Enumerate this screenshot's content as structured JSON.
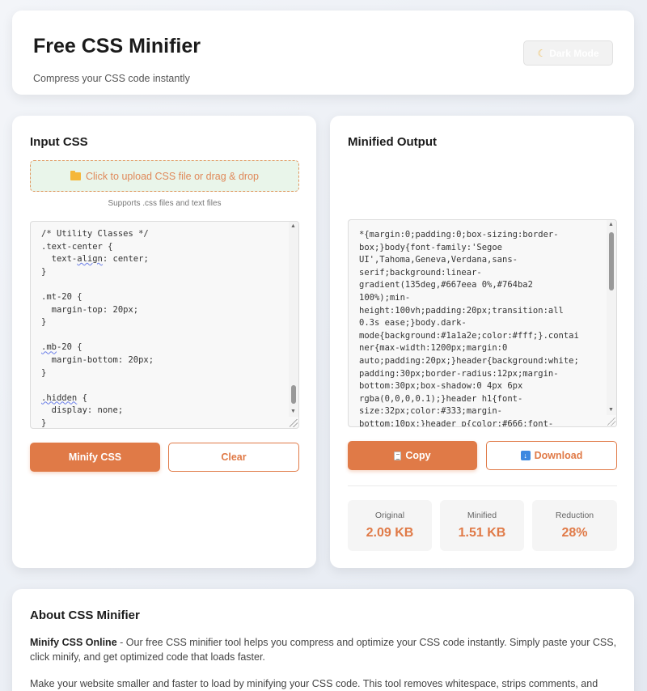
{
  "header": {
    "title": "Free CSS Minifier",
    "subtitle": "Compress your CSS code instantly",
    "dark_mode_label": "Dark Mode",
    "dark_mode_icon": "moon-icon"
  },
  "input": {
    "title": "Input CSS",
    "upload_label": "Click to upload CSS file or drag & drop",
    "upload_icon": "folder-icon",
    "upload_note": "Supports .css files and text files",
    "code_lines": [
      "/* Utility Classes */",
      ".text-center {",
      "  text-align: center;",
      "}",
      "",
      ".mt-20 {",
      "  margin-top: 20px;",
      "}",
      "",
      ".mb-20 {",
      "  margin-bottom: 20px;",
      "}",
      "",
      ".hidden {",
      "  display: none;",
      "}"
    ],
    "minify_label": "Minify CSS",
    "clear_label": "Clear"
  },
  "output": {
    "title": "Minified Output",
    "code_lines": [
      "*{margin:0;padding:0;box-sizing:border-",
      "box;}body{font-family:'Segoe",
      "UI',Tahoma,Geneva,Verdana,sans-",
      "serif;background:linear-",
      "gradient(135deg,#667eea 0%,#764ba2",
      "100%);min-",
      "height:100vh;padding:20px;transition:all",
      "0.3s ease;}body.dark-",
      "mode{background:#1a1a2e;color:#fff;}.contai",
      "ner{max-width:1200px;margin:0",
      "auto;padding:20px;}header{background:white;",
      "padding:30px;border-radius:12px;margin-",
      "bottom:30px;box-shadow:0 4px 6px",
      "rgba(0,0,0,0.1);}header h1{font-",
      "size:32px;color:#333;margin-",
      "bottom:10px;}header p{color:#666;font-"
    ],
    "copy_label": "Copy",
    "copy_icon": "clipboard-icon",
    "download_label": "Download",
    "download_icon": "download-icon",
    "stats": {
      "original_label": "Original",
      "original_value": "2.09 KB",
      "minified_label": "Minified",
      "minified_value": "1.51 KB",
      "reduction_label": "Reduction",
      "reduction_value": "28%"
    }
  },
  "about": {
    "title": "About CSS Minifier",
    "p1_bold": "Minify CSS Online",
    "p1_text": " - Our free CSS minifier tool helps you compress and optimize your CSS code instantly. Simply paste your CSS, click minify, and get optimized code that loads faster.",
    "p2_text": "Make your website smaller and faster to load by minifying your CSS code. This tool removes whitespace, strips comments, and optimizes"
  },
  "colors": {
    "accent": "#e07a47",
    "upload_bg": "#e9f5ea",
    "download_icon": "#3c88e0"
  }
}
